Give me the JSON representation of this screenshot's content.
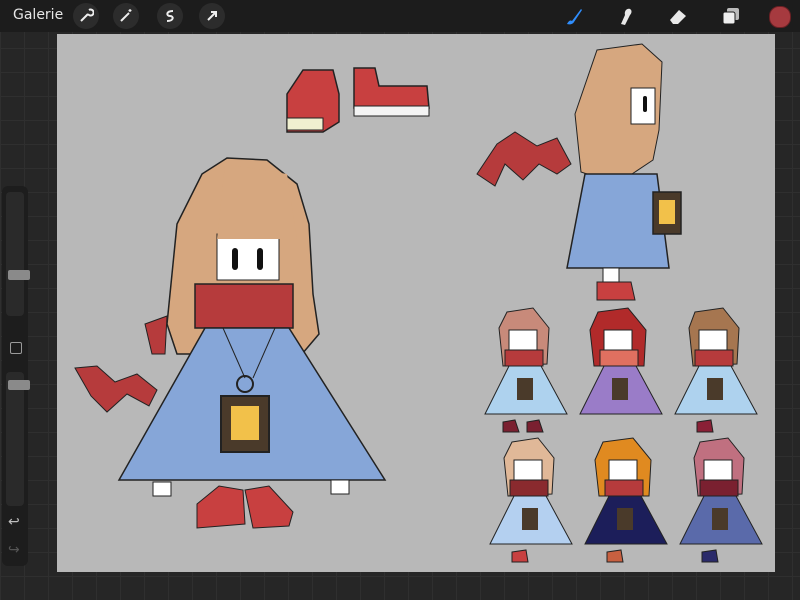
{
  "app": {
    "gallery_label": "Galerie"
  },
  "toolbar_left": {
    "icons": [
      "wrench-icon",
      "magic-wand-icon",
      "selection-icon",
      "transform-arrow-icon"
    ]
  },
  "toolbar_right": {
    "icons": [
      "brush-icon",
      "smudge-icon",
      "eraser-icon",
      "layers-icon"
    ],
    "active_color": "#a63a3f"
  },
  "sidebar": {
    "brush_size_level": 0.68,
    "opacity_level": 0.08,
    "undo_symbol": "↩",
    "redo_symbol": "↪"
  },
  "canvas": {
    "background": "#b8b8b8"
  },
  "colors": {
    "character_blue": "#86a6d8",
    "scarf_red": "#b63b3c",
    "hair_tan": "#d6a77f"
  }
}
